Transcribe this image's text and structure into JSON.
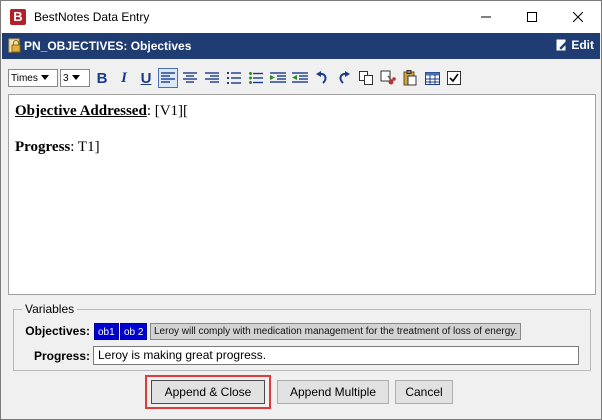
{
  "window": {
    "title": "BestNotes Data Entry",
    "app_icon_letter": "B"
  },
  "header": {
    "title": "PN_OBJECTIVES: Objectives",
    "edit_label": "Edit"
  },
  "toolbar": {
    "font_value": "Times",
    "size_value": "3",
    "bold": "B",
    "italic": "I",
    "underline": "U",
    "icons": [
      "align-left-icon",
      "align-center-icon",
      "align-right-icon",
      "numbered-list-icon",
      "bulleted-list-icon",
      "indent-icon",
      "outdent-icon",
      "undo-icon",
      "redo-icon",
      "copy-icon",
      "cut-icon",
      "paste-icon",
      "table-icon",
      "checkbox-icon"
    ]
  },
  "editor": {
    "line1_label": "Objective Addressed",
    "line1_value": ": [V1][",
    "line2_label": "Progress",
    "line2_value": ": T1]"
  },
  "variables": {
    "legend": "Variables",
    "objectives_label": "Objectives:",
    "chip1": "ob1",
    "chip2": "ob 2",
    "objective_text": "Leroy will comply with medication management for the treatment of loss of energy.",
    "progress_label": "Progress:",
    "progress_value": "Leroy is making great progress."
  },
  "buttons": {
    "append_close": "Append & Close",
    "append_multiple": "Append Multiple",
    "cancel": "Cancel"
  },
  "colors": {
    "header_bg": "#1f3d72",
    "chip_bg": "#0000d0",
    "highlight": "#e03a3a"
  }
}
